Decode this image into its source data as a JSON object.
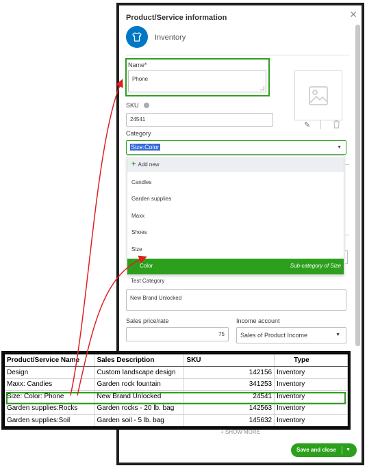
{
  "panel": {
    "title": "Product/Service information",
    "type_label": "Inventory",
    "name_label": "Name*",
    "name_value": "Phone",
    "sku_label": "SKU",
    "sku_value": "24541",
    "category_label": "Category",
    "category_value": "Size:Color",
    "dropdown": {
      "add_new": "Add new",
      "items": [
        "Candles",
        "Garden supplies",
        "Maxx",
        "Shoes",
        "Size"
      ],
      "active_item": "Color",
      "active_hint": "Sub-category of Size",
      "last_item": "Test Category"
    },
    "description_value": "New Brand Unlocked",
    "sales_price_label": "Sales price/rate",
    "sales_price_value": "75",
    "income_account_label": "Income account",
    "income_account_value": "Sales of Product Income",
    "show_more": "+ SHOW MORE",
    "save_button": "Save and close"
  },
  "spreadsheet": {
    "headers": [
      "Product/Service Name",
      "Sales Description",
      "SKU",
      "Type"
    ],
    "rows": [
      [
        "Design",
        "Custom landscape design",
        "142156",
        "Inventory"
      ],
      [
        "Maxx: Candies",
        "Garden rock fountain",
        "341253",
        "Inventory"
      ],
      [
        "Size: Color: Phone",
        "New Brand Unlocked",
        "24541",
        "Inventory"
      ],
      [
        "Garden supplies:Rocks",
        "Garden rocks - 20 lb. bag",
        "142563",
        "Inventory"
      ],
      [
        "Garden supplies:Soil",
        "Garden soil - 5 lb. bag",
        "145632",
        "Inventory"
      ]
    ],
    "highlighted_row": 2
  },
  "colors": {
    "accent_green": "#2ca01c",
    "type_blue": "#0077c5",
    "arrow_red": "#e02020",
    "selection_blue": "#3367d6"
  },
  "icons": [
    "close-icon",
    "shirt-icon",
    "image-placeholder-icon",
    "pencil-icon",
    "trash-icon",
    "info-icon",
    "caret-down-icon",
    "plus-icon"
  ]
}
